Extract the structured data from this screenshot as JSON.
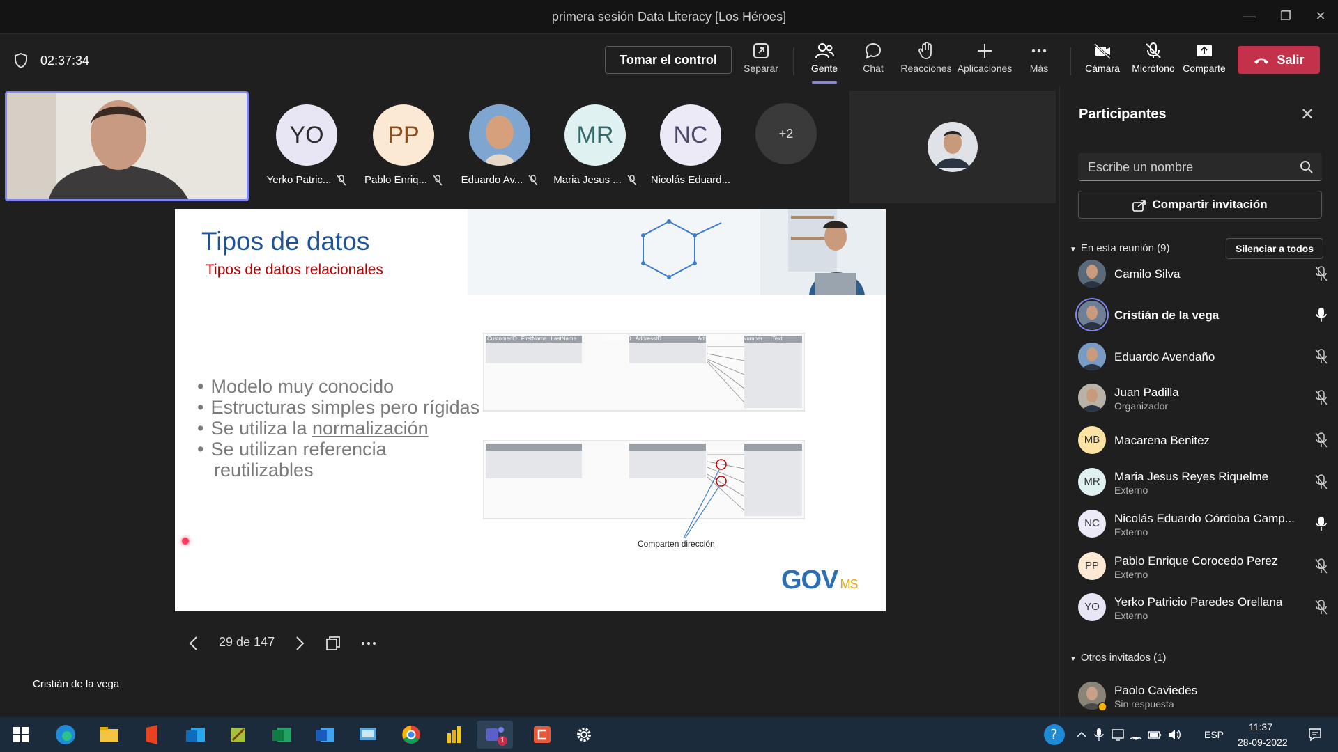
{
  "window": {
    "title": "primera sesión Data Literacy [Los Héroes]"
  },
  "toolbar": {
    "timer": "02:37:34",
    "take_control": "Tomar el control",
    "separar": "Separar",
    "gente": "Gente",
    "chat": "Chat",
    "reacciones": "Reacciones",
    "aplicaciones": "Aplicaciones",
    "mas": "Más",
    "camara": "Cámara",
    "microfono": "Micrófono",
    "comparte": "Comparte",
    "salir": "Salir"
  },
  "gallery": [
    {
      "initials": "YO",
      "name": "Yerko Patric...",
      "color": "#e8e6f5"
    },
    {
      "initials": "PP",
      "name": "Pablo Enriq...",
      "color": "#fce9d4"
    },
    {
      "initials": "",
      "name": "Eduardo Av...",
      "color": "#7a9bc4"
    },
    {
      "initials": "MR",
      "name": "Maria Jesus ...",
      "color": "#dff1f0"
    },
    {
      "initials": "NC",
      "name": "Nicolás Eduard...",
      "color": "#eceaf6"
    }
  ],
  "gallery_more": "+2",
  "slide": {
    "title": "Tipos de datos",
    "subtitle": "Tipos de datos relacionales",
    "bullets": [
      "Modelo muy conocido",
      "Estructuras simples pero rígidas",
      "Se utiliza la ",
      "Se utilizan referencia"
    ],
    "bullet3_link": "normalización",
    "bullet4_cont": "reutilizables",
    "caption": "Comparten dirección",
    "logo_main": "GOV",
    "logo_sub": "MS",
    "table_headers": [
      "CustomerID",
      "FirstName",
      "LastName",
      "CustomerID",
      "AddressID",
      "AddressID",
      "LineNumber",
      "Text"
    ]
  },
  "navigation": {
    "page": "29 de 147"
  },
  "speaker_name": "Cristián de la vega",
  "panel": {
    "title": "Participantes",
    "search_placeholder": "Escribe un nombre",
    "share_invite": "Compartir invitación",
    "in_meeting": "En esta reunión (9)",
    "mute_all": "Silenciar a todos",
    "others": "Otros invitados (1)",
    "participants": [
      {
        "name": "Camilo Silva",
        "role": "",
        "initials": "",
        "color": "#5b6a7a",
        "mic": "muted"
      },
      {
        "name": "Cristián de la vega",
        "role": "",
        "initials": "",
        "color": "#6e7f96",
        "mic": "on"
      },
      {
        "name": "Eduardo Avendaño",
        "role": "",
        "initials": "",
        "color": "#7a9bc4",
        "mic": "muted"
      },
      {
        "name": "Juan Padilla",
        "role": "Organizador",
        "initials": "",
        "color": "#b9b3a7",
        "mic": "muted"
      },
      {
        "name": "Macarena Benitez",
        "role": "",
        "initials": "MB",
        "color": "#fbe3a4",
        "mic": "muted"
      },
      {
        "name": "Maria Jesus Reyes Riquelme",
        "role": "Externo",
        "initials": "MR",
        "color": "#dff1f0",
        "mic": "muted"
      },
      {
        "name": "Nicolás Eduardo Córdoba Camp...",
        "role": "Externo",
        "initials": "NC",
        "color": "#eceaf6",
        "mic": "on"
      },
      {
        "name": "Pablo Enrique Corocedo Perez",
        "role": "Externo",
        "initials": "PP",
        "color": "#fce9d4",
        "mic": "muted"
      },
      {
        "name": "Yerko Patricio Paredes Orellana",
        "role": "Externo",
        "initials": "YO",
        "color": "#e8e6f5",
        "mic": "muted"
      }
    ],
    "invited": [
      {
        "name": "Paolo Caviedes",
        "role": "Sin respuesta",
        "color": "#8a8378"
      }
    ]
  },
  "taskbar": {
    "lang": "ESP",
    "time": "11:37",
    "date": "28-09-2022",
    "teams_badge": "1"
  },
  "colors": {
    "accent": "#7f85f5",
    "leave": "#c4314b",
    "slide_title": "#1f5296",
    "slide_subtitle": "#c00000"
  }
}
